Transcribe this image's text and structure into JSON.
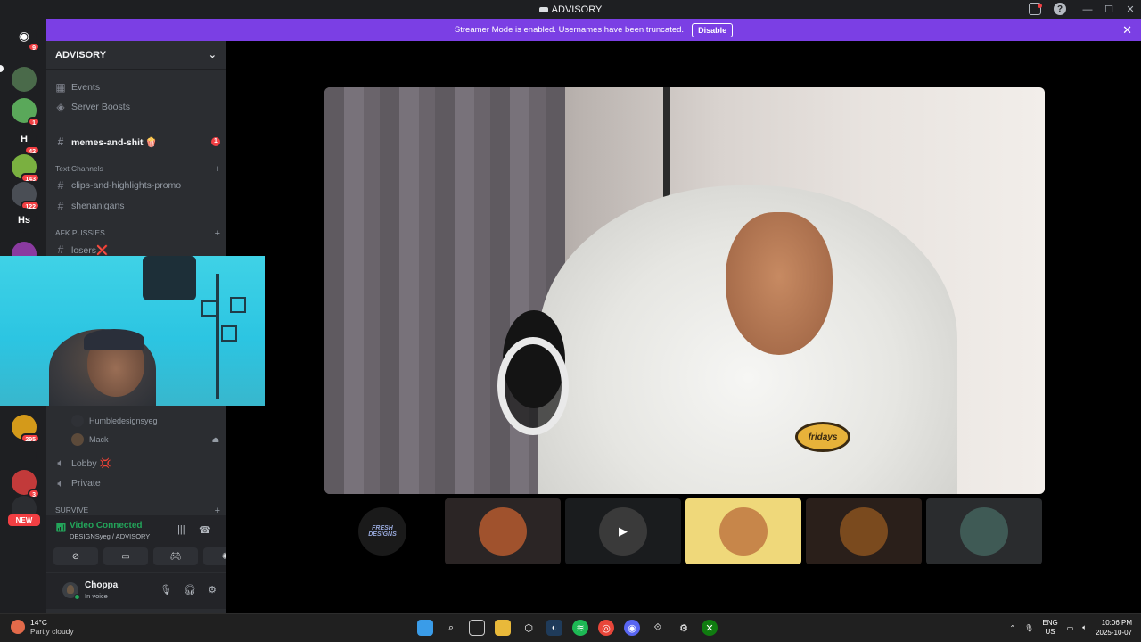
{
  "window": {
    "title": "ADVISORY",
    "controls": [
      "—",
      "☐",
      "✕"
    ]
  },
  "banner": {
    "message": "Streamer Mode is enabled. Usernames have been truncated.",
    "disable_label": "Disable"
  },
  "server_rail": {
    "home_badge": "9",
    "servers": [
      {
        "label": "",
        "badge": "",
        "color": "#4a6a4a"
      },
      {
        "label": "",
        "badge": "1",
        "color": "#5aa85a"
      },
      {
        "label": "H",
        "badge": "42",
        "color": "#1e1f22"
      },
      {
        "label": "",
        "badge": "143",
        "color": "#7ab040"
      },
      {
        "label": "",
        "badge": "122",
        "color": "#4a4e55"
      },
      {
        "label": "Hs",
        "badge": "",
        "color": "#1e1f22"
      },
      {
        "label": "",
        "badge": "445",
        "color": "#8a3aa0"
      },
      {
        "label": "",
        "badge": "295",
        "color": "#d49a1a"
      },
      {
        "label": "",
        "badge": "",
        "color": "#1e1f22"
      },
      {
        "label": "",
        "badge": "3",
        "color": "#c23a3a"
      },
      {
        "label": "",
        "badge": "",
        "color": "#2b2d31"
      }
    ],
    "new_label": "NEW"
  },
  "sidebar": {
    "guild_name": "ADVISORY",
    "items": [
      {
        "icon": "calendar-icon",
        "label": "Events"
      },
      {
        "icon": "boost-icon",
        "label": "Server Boosts"
      }
    ],
    "unread_channel": {
      "label": "memes-and-shit 🍿",
      "badge": "1"
    },
    "categories": {
      "text": "Text Channels",
      "afk": "AFK PUSSIES",
      "survive": "SURVIVE"
    },
    "text_channels": [
      "clips-and-highlights-promo",
      "shenanigans"
    ],
    "afk_channels": [
      "losers❌"
    ],
    "voice_users": [
      "Humbledesignsyeg",
      "Mack"
    ],
    "voice_channels": [
      "Lobby 💢",
      "Private"
    ]
  },
  "voice_panel": {
    "status": "Video Connected",
    "location": "DESIGNSyeg / ADVISORY"
  },
  "user_panel": {
    "name": "Choppa",
    "status": "In voice"
  },
  "stage": {
    "patch_text": "fridays",
    "tiles": [
      {
        "kind": "logo",
        "bg": "#000000",
        "avatar": "#1a1a1a",
        "label": "FRESH DESIGNS"
      },
      {
        "kind": "avatar",
        "bg": "#2b2525",
        "avatar": "#a0522d",
        "label": ""
      },
      {
        "kind": "camera",
        "bg": "#1a1c1e",
        "avatar": "#3a3a3a",
        "label": ""
      },
      {
        "kind": "avatar",
        "bg": "#efd87a",
        "avatar": "#c7864a",
        "label": ""
      },
      {
        "kind": "avatar",
        "bg": "#2a1f1a",
        "avatar": "#7a4a1e",
        "label": ""
      },
      {
        "kind": "avatar",
        "bg": "#2a2c2e",
        "avatar": "#3f5a55",
        "label": ""
      }
    ]
  },
  "taskbar": {
    "weather_temp": "14°C",
    "weather_desc": "Partly cloudy",
    "lang_top": "ENG",
    "lang_bottom": "US",
    "time": "10:06 PM",
    "date": "2025-10-07"
  }
}
